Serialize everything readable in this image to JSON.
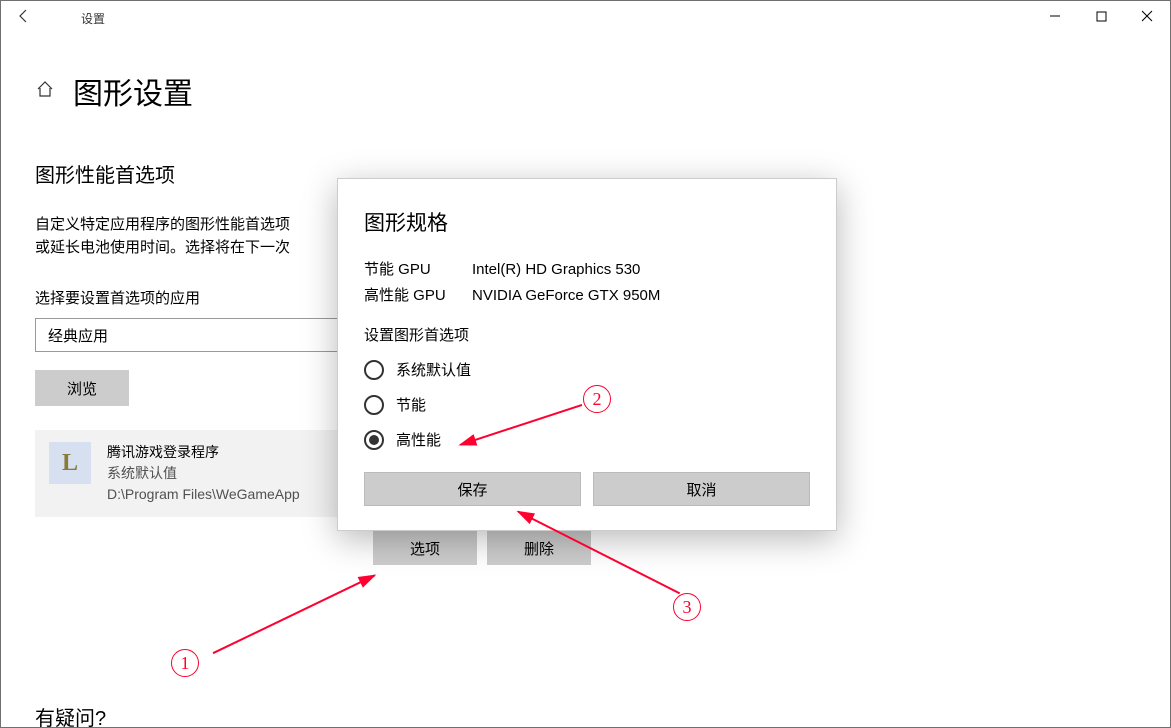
{
  "titlebar": {
    "title": "设置"
  },
  "page": {
    "title": "图形设置",
    "section_heading": "图形性能首选项",
    "description_1": "自定义特定应用程序的图形性能首选项",
    "description_2": "或延长电池使用时间。选择将在下一次",
    "select_label": "选择要设置首选项的应用",
    "dropdown_value": "经典应用",
    "browse_label": "浏览",
    "help": "有疑问?"
  },
  "app": {
    "name": "腾讯游戏登录程序",
    "setting": "系统默认值",
    "path": "D:\\Program Files\\WeGameApp",
    "options_label": "选项",
    "delete_label": "删除"
  },
  "dialog": {
    "title": "图形规格",
    "power_save_key": "节能 GPU",
    "power_save_val": "Intel(R) HD Graphics 530",
    "high_perf_key": "高性能 GPU",
    "high_perf_val": "NVIDIA GeForce GTX 950M",
    "pref_label": "设置图形首选项",
    "radio_default": "系统默认值",
    "radio_power": "节能",
    "radio_high": "高性能",
    "save": "保存",
    "cancel": "取消"
  },
  "annotations": {
    "n1": "1",
    "n2": "2",
    "n3": "3"
  }
}
